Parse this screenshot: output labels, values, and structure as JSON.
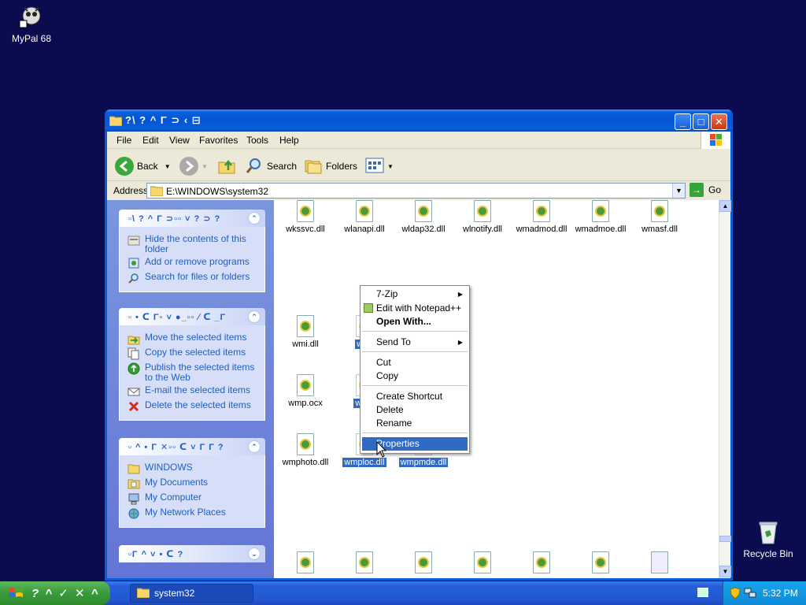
{
  "desktop": {
    "icons": [
      {
        "label": "MyPal 68",
        "name": "mypal-icon"
      },
      {
        "label": "Recycle Bin",
        "name": "recycle-bin-icon"
      }
    ]
  },
  "window": {
    "title": "?\\ ? ^ Γ ⊃ ‹ ⊟",
    "menu": [
      "File",
      "Edit",
      "View",
      "Favorites",
      "Tools",
      "Help"
    ],
    "toolbar": {
      "back": "Back",
      "search": "Search",
      "folders": "Folders"
    },
    "address": {
      "label": "Address",
      "value": "E:\\WINDOWS\\system32",
      "go": "Go"
    }
  },
  "left_pane": {
    "sections": [
      {
        "header": "▫\\ ? ^ Γ ⊃▫▫ ˅ ? ⊃ ?",
        "chevron": "⌃",
        "links": [
          {
            "label": "Hide the contents of this folder",
            "icon": "folder-hide-icon"
          },
          {
            "label": "Add or remove programs",
            "icon": "add-remove-programs-icon"
          },
          {
            "label": "Search for files or folders",
            "icon": "search-icon"
          }
        ]
      },
      {
        "header": "▫ • ᑕ Γ▫ ˅ ●_▫▫ ∕ ᑕ _Γ",
        "chevron": "⌃",
        "links": [
          {
            "label": "Move the selected items",
            "icon": "move-icon"
          },
          {
            "label": "Copy the selected items",
            "icon": "copy-icon"
          },
          {
            "label": "Publish the selected items to the Web",
            "icon": "publish-web-icon"
          },
          {
            "label": "E-mail the selected items",
            "icon": "email-icon"
          },
          {
            "label": "Delete the selected items",
            "icon": "delete-icon"
          }
        ]
      },
      {
        "header": "▫ ^ • Γ ✕▫▫ ᑕ ˅ Γ Γ ?",
        "chevron": "⌃",
        "links": [
          {
            "label": "WINDOWS",
            "icon": "folder-icon"
          },
          {
            "label": "My Documents",
            "icon": "my-documents-icon"
          },
          {
            "label": "My Computer",
            "icon": "my-computer-icon"
          },
          {
            "label": "My Network Places",
            "icon": "network-places-icon"
          }
        ]
      },
      {
        "header": "▫Γ ^ ˅ • ᑕ ?",
        "chevron": "⌄",
        "links": []
      }
    ]
  },
  "files": {
    "row1": [
      "wkssvc.dll",
      "wlanapi.dll",
      "wldap32.dll",
      "wlnotify.dll",
      "wmadmod.dll",
      "wmadmoe.dll",
      "wmasf.dll"
    ],
    "row2": [
      "wmi.dll",
      "wmi"
    ],
    "row3": [
      "wmp.ocx",
      "wmp"
    ],
    "row4": [
      "wmphoto.dll",
      "wmploc.dll",
      "wmpmde.dll"
    ]
  },
  "context_menu": {
    "items": [
      "7-Zip",
      "Edit with Notepad++",
      "Open With...",
      "Send To",
      "Cut",
      "Copy",
      "Create Shortcut",
      "Delete",
      "Rename",
      "Properties"
    ]
  },
  "taskbar": {
    "start": "? ^ ✓ ✕ ^",
    "task": "system32",
    "clock": "5:32 PM"
  },
  "colors": {
    "desktop": "#0b0b4f",
    "selection": "#316ac5",
    "link": "#215dc6"
  }
}
